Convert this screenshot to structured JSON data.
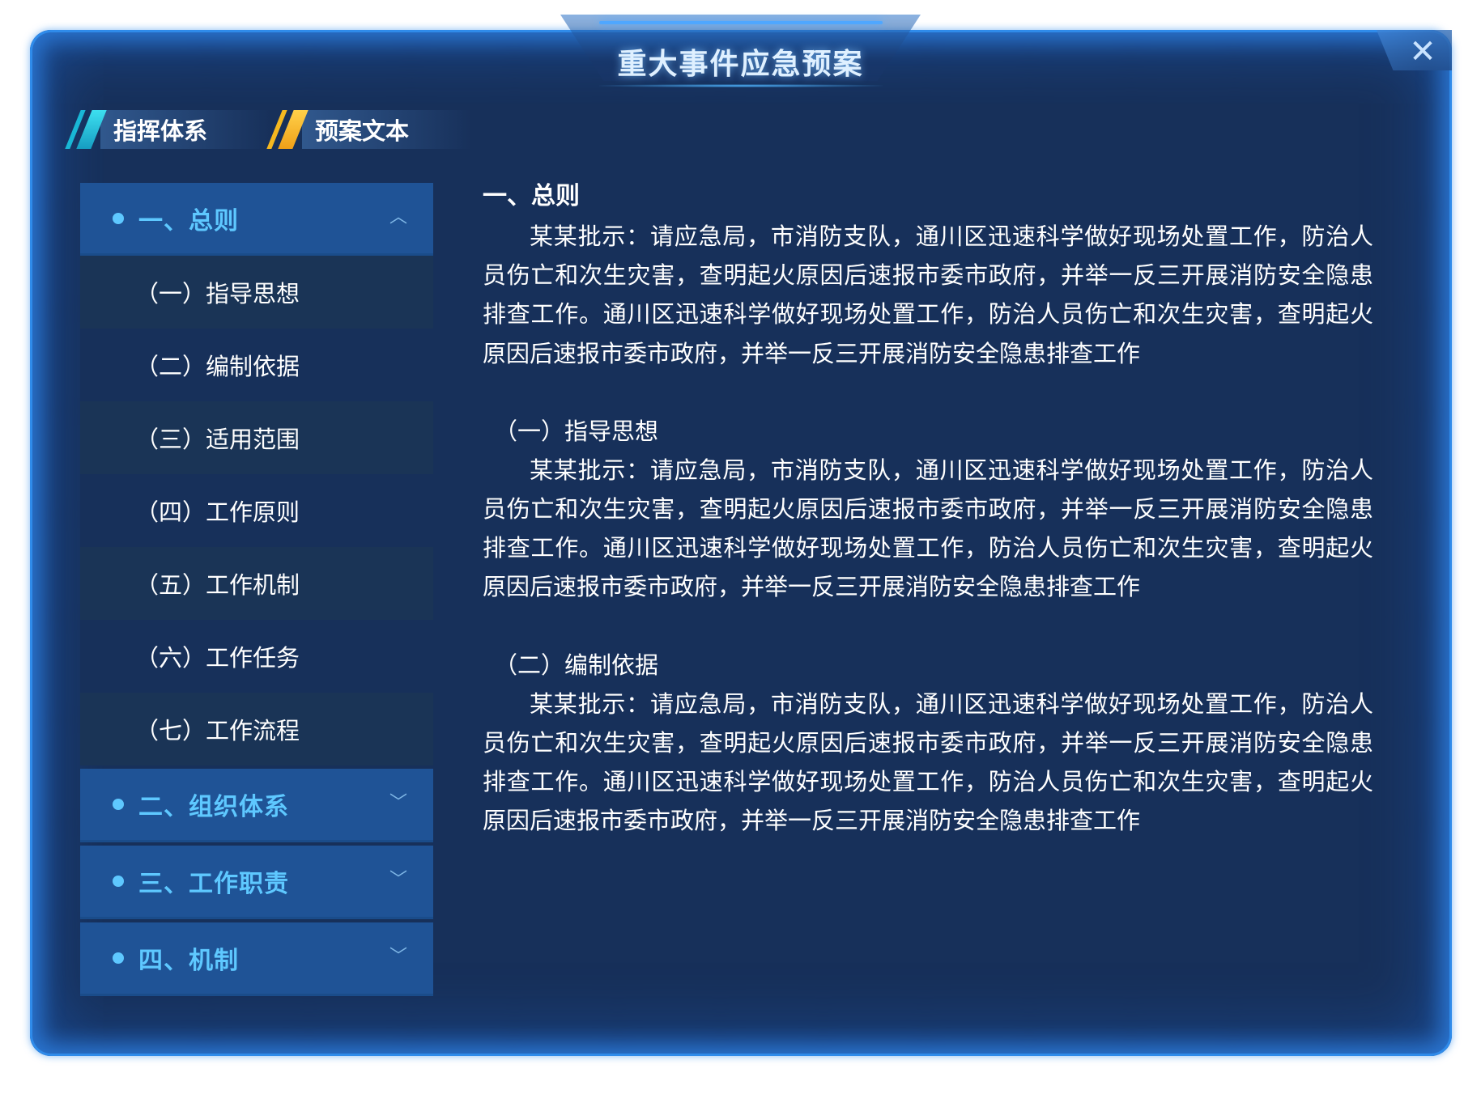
{
  "window": {
    "title": "重大事件应急预案",
    "close_symbol": "✕"
  },
  "tabs": [
    {
      "label": "指挥体系",
      "active": false
    },
    {
      "label": "预案文本",
      "active": true
    }
  ],
  "sidebar": {
    "sections": [
      {
        "label": "一、总则",
        "expanded": true,
        "items": [
          {
            "label": "（一）指导思想"
          },
          {
            "label": "（二）编制依据"
          },
          {
            "label": "（三）适用范围"
          },
          {
            "label": "（四）工作原则"
          },
          {
            "label": "（五）工作机制"
          },
          {
            "label": "（六）工作任务"
          },
          {
            "label": "（七）工作流程"
          }
        ]
      },
      {
        "label": "二、组织体系",
        "expanded": false
      },
      {
        "label": "三、工作职责",
        "expanded": false
      },
      {
        "label": "四、机制",
        "expanded": false
      }
    ]
  },
  "content": {
    "heading": "一、总则",
    "intro": "某某批示：请应急局，市消防支队，通川区迅速科学做好现场处置工作，防治人员伤亡和次生灾害，查明起火原因后速报市委市政府，并举一反三开展消防安全隐患排查工作。通川区迅速科学做好现场处置工作，防治人员伤亡和次生灾害，查明起火原因后速报市委市政府，并举一反三开展消防安全隐患排查工作",
    "sections": [
      {
        "title": "（一）指导思想",
        "text": "某某批示：请应急局，市消防支队，通川区迅速科学做好现场处置工作，防治人员伤亡和次生灾害，查明起火原因后速报市委市政府，并举一反三开展消防安全隐患排查工作。通川区迅速科学做好现场处置工作，防治人员伤亡和次生灾害，查明起火原因后速报市委市政府，并举一反三开展消防安全隐患排查工作"
      },
      {
        "title": "（二）编制依据",
        "text": "某某批示：请应急局，市消防支队，通川区迅速科学做好现场处置工作，防治人员伤亡和次生灾害，查明起火原因后速报市委市政府，并举一反三开展消防安全隐患排查工作。通川区迅速科学做好现场处置工作，防治人员伤亡和次生灾害，查明起火原因后速报市委市政府，并举一反三开展消防安全隐患排查工作"
      }
    ]
  },
  "icons": {
    "close": "close-icon",
    "chevron_up": "chevron-up-icon",
    "chevron_down": "chevron-down-icon"
  },
  "colors": {
    "panel_bg": "#17305a",
    "border_glow": "#2f8bea",
    "section_bg": "#1f5396",
    "section_text": "#5ec8ff",
    "tab1_accent": "#19b7d6",
    "tab2_accent": "#f5b820"
  }
}
